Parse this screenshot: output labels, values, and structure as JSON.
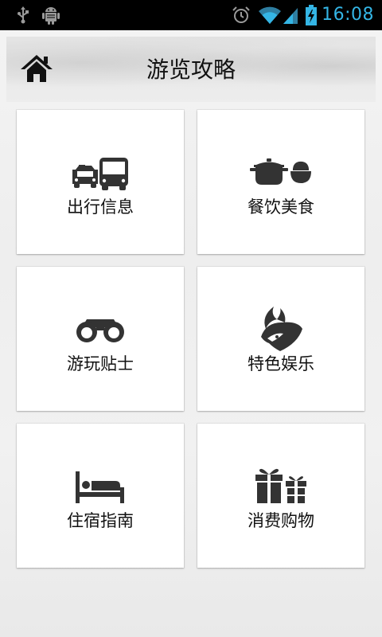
{
  "status_bar": {
    "time": "16:08",
    "icons": [
      "usb-icon",
      "android-debug-icon",
      "alarm-icon",
      "wifi-icon",
      "signal-icon",
      "battery-charging-icon"
    ],
    "time_color": "#34b5e5"
  },
  "header": {
    "title": "游览攻略",
    "home_icon": "home-icon"
  },
  "menu": [
    {
      "label": "出行信息",
      "icon": "transport-icon"
    },
    {
      "label": "餐饮美食",
      "icon": "cookware-icon"
    },
    {
      "label": "游玩贴士",
      "icon": "binoculars-icon"
    },
    {
      "label": "特色娱乐",
      "icon": "opera-mask-icon"
    },
    {
      "label": "住宿指南",
      "icon": "bed-icon"
    },
    {
      "label": "消费购物",
      "icon": "gift-icon"
    }
  ]
}
